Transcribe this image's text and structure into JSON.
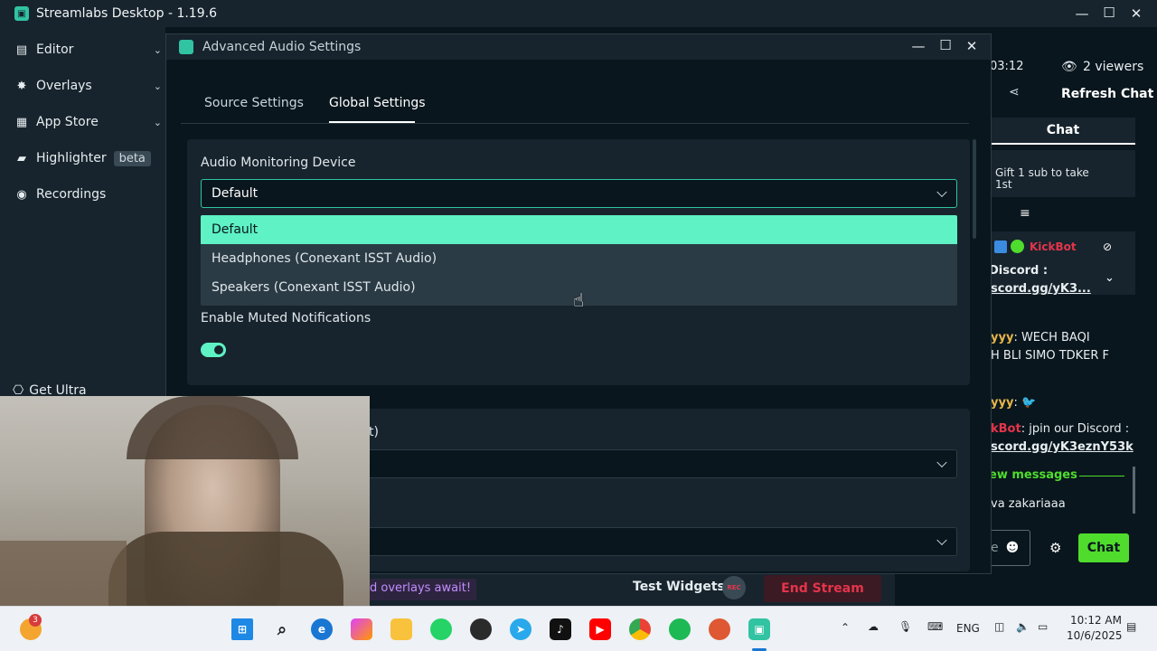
{
  "app": {
    "title": "Streamlabs Desktop - 1.19.6",
    "controls": {
      "minimize": "—",
      "maximize": "☐",
      "close": "✕"
    }
  },
  "sidebar": {
    "items": [
      {
        "label": "Editor",
        "icon": "editor-icon"
      },
      {
        "label": "Overlays",
        "icon": "overlays-icon"
      },
      {
        "label": "App Store",
        "icon": "store-icon"
      },
      {
        "label": "Highlighter",
        "icon": "highlighter-icon",
        "badge": "beta"
      },
      {
        "label": "Recordings",
        "icon": "recordings-icon"
      }
    ],
    "get_ultra": "Get Ultra"
  },
  "chat": {
    "timer": "03:12",
    "viewers": "2 viewers",
    "refresh": "Refresh Chat",
    "header": "Chat",
    "gift_line1": "Gift 1 sub to take",
    "gift_line2": "1st",
    "bot_name": "KickBot",
    "pinned_line1": "Discord :",
    "pinned_line2": "scord.gg/yK3...",
    "msg1_user": "yyy",
    "msg1_text_a": ": WECH BAQI",
    "msg1_text_b": "H BLI SIMO TDKER F",
    "msg2_user": "yyy",
    "msg2_text": ":",
    "msg3_user": "kBot",
    "msg3_text": ": jpin our Discord :",
    "msg3_link": "scord.gg/yK3eznY53k",
    "new_messages": "ew messages",
    "msg4_text": "va zakariaaa",
    "input_placeholder": "e",
    "chat_button": "Chat"
  },
  "modal": {
    "title": "Advanced Audio Settings",
    "tabs": [
      {
        "label": "Source Settings",
        "active": false
      },
      {
        "label": "Global Settings",
        "active": true
      }
    ],
    "monitoring": {
      "label": "Audio Monitoring Device",
      "value": "Default",
      "options": [
        "Default",
        "Headphones (Conexant ISST Audio)",
        "Speakers (Conexant ISST Audio)"
      ],
      "selected_index": 0
    },
    "muted_notifications": {
      "label": "Enable Muted Notifications",
      "enabled": true
    },
    "partial_label": "t)"
  },
  "bottom_bar": {
    "promo": "d overlays await!",
    "test_widgets": "Test Widgets",
    "rec": "REC",
    "end_stream": "End Stream"
  },
  "taskbar": {
    "badge_count": "3",
    "lang": "ENG",
    "time": "10:12 AM",
    "date": "10/6/2025"
  },
  "colors": {
    "accent": "#5ef2c4",
    "teal": "#31c3a2",
    "end_stream": "#e5344a",
    "chat_button": "#4fdc2d",
    "panel": "#17242d",
    "background": "#09161d"
  }
}
